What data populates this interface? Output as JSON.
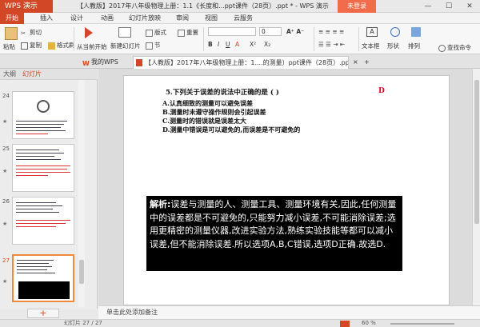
{
  "titlebar": {
    "app_button": "WPS 演示",
    "document_title": "【人教版】2017年八年级物理上册：1.1《长度和...ppt课件（28页）.ppt * - WPS 演示",
    "login_button": "未登录"
  },
  "menu": {
    "tabs": [
      "开始",
      "插入",
      "设计",
      "动画",
      "幻灯片放映",
      "审阅",
      "视图",
      "云服务"
    ]
  },
  "ribbon": {
    "paste": "粘贴",
    "cut": "剪切",
    "copy": "复制",
    "format_painter": "格式刷",
    "play_from_current": "从当前开始",
    "new_slide": "新建幻灯片",
    "layout": "版式",
    "reset": "重置",
    "section": "节",
    "font_size_value": "0",
    "text_box": "文本框",
    "shape": "形状",
    "arrange": "排列",
    "find_command": "查找命令"
  },
  "doc_tabs": {
    "tab1": "我的WPS",
    "tab2": "【人教版】2017年八年级物理上册：1....的测量）ppt课件（28页）.ppt *"
  },
  "left_panel": {
    "tab_outline": "大纲",
    "tab_slides": "幻灯片",
    "slides": [
      {
        "num": "24",
        "star": "★"
      },
      {
        "num": "25",
        "star": "★"
      },
      {
        "num": "26",
        "star": "★"
      },
      {
        "num": "27",
        "star": "★"
      }
    ]
  },
  "slide": {
    "question": "5.下列关于误差的说法中正确的是    (       )",
    "answer": "D",
    "options": [
      "A.认真细致的测量可以避免误差",
      "B.测量时未遵守操作规则会引起误差",
      "C.测量时的错误就是误差太大",
      "D.测量中错误是可以避免的,而误差是不可避免的"
    ],
    "explanation_lead": "解析:",
    "explanation_body": "误差与测量的人、测量工具、测量环境有关,因此,任何测量中的误差都是不可避免的,只能努力减小误差,不可能消除误差;选用更精密的测量仪器,改进实验方法,熟练实验技能等都可以减小误差,但不能消除误差.所以选项A,B,C错误,选项D正确.故选D."
  },
  "notes": {
    "placeholder": "单击此处添加备注"
  },
  "status": {
    "slide_counter": "幻灯片 27 / 27",
    "zoom": "60 %"
  },
  "colors": {
    "accent": "#d24726",
    "answer_red": "#e0001b"
  }
}
